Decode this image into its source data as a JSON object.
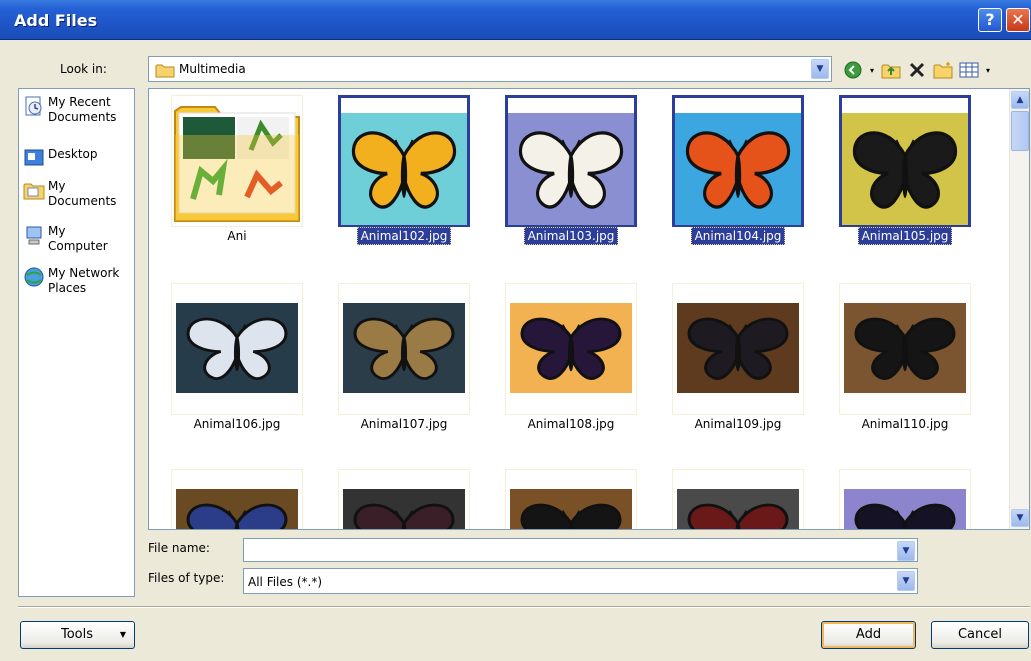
{
  "window": {
    "title": "Add Files",
    "help_glyph": "?",
    "close_glyph": "✕"
  },
  "lookin": {
    "label": "Look in:",
    "value": "Multimedia"
  },
  "toolbar": {
    "icons": [
      "back-icon",
      "up-folder-icon",
      "delete-icon",
      "new-folder-icon",
      "views-icon"
    ]
  },
  "places": [
    {
      "label": "My Recent\nDocuments",
      "icon": "recent-documents-icon"
    },
    {
      "label": "Desktop",
      "icon": "desktop-icon"
    },
    {
      "label": "My\nDocuments",
      "icon": "my-documents-icon"
    },
    {
      "label": "My\nComputer",
      "icon": "my-computer-icon"
    },
    {
      "label": "My Network\nPlaces",
      "icon": "network-places-icon"
    }
  ],
  "files": [
    {
      "name": "Ani",
      "type": "folder",
      "selected": false
    },
    {
      "name": "Animal102.jpg",
      "selected": true,
      "bg": "#6FCFD8",
      "wing": "#F2B01E"
    },
    {
      "name": "Animal103.jpg",
      "selected": true,
      "bg": "#8A8FD2",
      "wing": "#F4F1E8"
    },
    {
      "name": "Animal104.jpg",
      "selected": true,
      "bg": "#3BA6E0",
      "wing": "#E5531B"
    },
    {
      "name": "Animal105.jpg",
      "selected": true,
      "bg": "#D2C448",
      "wing": "#1A1A1A"
    },
    {
      "name": "Animal106.jpg",
      "selected": false,
      "bg": "#263C4B",
      "wing": "#DDE4EE"
    },
    {
      "name": "Animal107.jpg",
      "selected": false,
      "bg": "#2A3D48",
      "wing": "#9A7A45"
    },
    {
      "name": "Animal108.jpg",
      "selected": false,
      "bg": "#F3B251",
      "wing": "#25163A"
    },
    {
      "name": "Animal109.jpg",
      "selected": false,
      "bg": "#5E3A1E",
      "wing": "#1D1A22"
    },
    {
      "name": "Animal110.jpg",
      "selected": false,
      "bg": "#7A5530",
      "wing": "#151515"
    },
    {
      "name": "",
      "selected": false,
      "bg": "#6A4A22",
      "wing": "#2B3C88"
    },
    {
      "name": "",
      "selected": false,
      "bg": "#333333",
      "wing": "#3A1E28"
    },
    {
      "name": "",
      "selected": false,
      "bg": "#7A5126",
      "wing": "#141414"
    },
    {
      "name": "",
      "selected": false,
      "bg": "#4A4A4A",
      "wing": "#6A1818"
    },
    {
      "name": "",
      "selected": false,
      "bg": "#8C84CC",
      "wing": "#161226"
    }
  ],
  "filename": {
    "label": "File name:",
    "value": ""
  },
  "filetype": {
    "label": "Files of type:",
    "value": "All Files (*.*)"
  },
  "buttons": {
    "tools": "Tools",
    "add": "Add",
    "cancel": "Cancel"
  }
}
